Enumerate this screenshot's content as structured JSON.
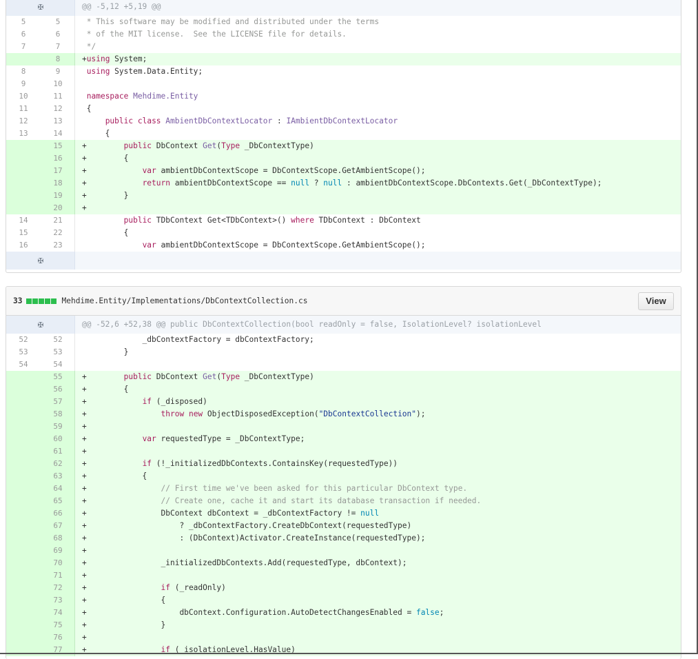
{
  "block1": {
    "hunk_header": "@@ -5,12 +5,19 @@",
    "lines": [
      {
        "type": "ctx",
        "old": "5",
        "new": "5",
        "html": "<span class=\"cm\"> * This software may be modified and distributed under the terms</span>"
      },
      {
        "type": "ctx",
        "old": "6",
        "new": "6",
        "html": "<span class=\"cm\"> * of the MIT license.  See the LICENSE file for details.</span>"
      },
      {
        "type": "ctx",
        "old": "7",
        "new": "7",
        "html": "<span class=\"cm\"> */</span>"
      },
      {
        "type": "add",
        "old": "",
        "new": "8",
        "html": "+<span class=\"kw\">using</span> System;"
      },
      {
        "type": "ctx",
        "old": "8",
        "new": "9",
        "html": " <span class=\"kw\">using</span> System.Data.Entity;"
      },
      {
        "type": "ctx",
        "old": "9",
        "new": "10",
        "html": ""
      },
      {
        "type": "ctx",
        "old": "10",
        "new": "11",
        "html": " <span class=\"kw\">namespace</span> <span class=\"ty\">Mehdime.Entity</span>"
      },
      {
        "type": "ctx",
        "old": "11",
        "new": "12",
        "html": " {"
      },
      {
        "type": "ctx",
        "old": "12",
        "new": "13",
        "html": "     <span class=\"kw\">public</span> <span class=\"kw\">class</span> <span class=\"ty\">AmbientDbContextLocator</span> : <span class=\"ty\">IAmbientDbContextLocator</span>"
      },
      {
        "type": "ctx",
        "old": "13",
        "new": "14",
        "html": "     {"
      },
      {
        "type": "add",
        "old": "",
        "new": "15",
        "html": "+        <span class=\"kw\">public</span> DbContext <span class=\"ty\">Get</span>(<span class=\"kw\">Type</span> _DbContextType)"
      },
      {
        "type": "add",
        "old": "",
        "new": "16",
        "html": "+        {"
      },
      {
        "type": "add",
        "old": "",
        "new": "17",
        "html": "+            <span class=\"kw\">var</span> ambientDbContextScope = DbContextScope.GetAmbientScope();"
      },
      {
        "type": "add",
        "old": "",
        "new": "18",
        "html": "+            <span class=\"kw\">return</span> ambientDbContextScope == <span class=\"nb\">null</span> ? <span class=\"nb\">null</span> : ambientDbContextScope.DbContexts.Get(_DbContextType);"
      },
      {
        "type": "add",
        "old": "",
        "new": "19",
        "html": "+        }"
      },
      {
        "type": "add",
        "old": "",
        "new": "20",
        "html": "+"
      },
      {
        "type": "ctx",
        "old": "14",
        "new": "21",
        "html": "         <span class=\"kw\">public</span> TDbContext Get&lt;TDbContext&gt;() <span class=\"kw\">where</span> TDbContext : DbContext"
      },
      {
        "type": "ctx",
        "old": "15",
        "new": "22",
        "html": "         {"
      },
      {
        "type": "ctx",
        "old": "16",
        "new": "23",
        "html": "             <span class=\"kw\">var</span> ambientDbContextScope = DbContextScope.GetAmbientScope();"
      }
    ]
  },
  "block2": {
    "count": "33",
    "path": "Mehdime.Entity/Implementations/DbContextCollection.cs",
    "view_label": "View",
    "hunk_header": "@@ -52,6 +52,38 @@ public DbContextCollection(bool readOnly = false, IsolationLevel? isolationLevel",
    "lines": [
      {
        "type": "ctx",
        "old": "52",
        "new": "52",
        "html": "             _dbContextFactory = dbContextFactory;"
      },
      {
        "type": "ctx",
        "old": "53",
        "new": "53",
        "html": "         }"
      },
      {
        "type": "ctx",
        "old": "54",
        "new": "54",
        "html": ""
      },
      {
        "type": "add",
        "old": "",
        "new": "55",
        "html": "+        <span class=\"kw\">public</span> DbContext <span class=\"ty\">Get</span>(<span class=\"kw\">Type</span> _DbContextType)"
      },
      {
        "type": "add",
        "old": "",
        "new": "56",
        "html": "+        {"
      },
      {
        "type": "add",
        "old": "",
        "new": "57",
        "html": "+            <span class=\"kw\">if</span> (_disposed)"
      },
      {
        "type": "add",
        "old": "",
        "new": "58",
        "html": "+                <span class=\"kw\">throw</span> <span class=\"kw\">new</span> ObjectDisposedException(<span class=\"st\">\"DbContextCollection\"</span>);"
      },
      {
        "type": "add",
        "old": "",
        "new": "59",
        "html": "+"
      },
      {
        "type": "add",
        "old": "",
        "new": "60",
        "html": "+            <span class=\"kw\">var</span> requestedType = _DbContextType;"
      },
      {
        "type": "add",
        "old": "",
        "new": "61",
        "html": "+"
      },
      {
        "type": "add",
        "old": "",
        "new": "62",
        "html": "+            <span class=\"kw\">if</span> (!_initializedDbContexts.ContainsKey(requestedType))"
      },
      {
        "type": "add",
        "old": "",
        "new": "63",
        "html": "+            {"
      },
      {
        "type": "add",
        "old": "",
        "new": "64",
        "html": "+                <span class=\"cm\">// First time we've been asked for this particular DbContext type.</span>"
      },
      {
        "type": "add",
        "old": "",
        "new": "65",
        "html": "+                <span class=\"cm\">// Create one, cache it and start its database transaction if needed.</span>"
      },
      {
        "type": "add",
        "old": "",
        "new": "66",
        "html": "+                DbContext dbContext = _dbContextFactory != <span class=\"nb\">null</span>"
      },
      {
        "type": "add",
        "old": "",
        "new": "67",
        "html": "+                    ? _dbContextFactory.CreateDbContext(requestedType)"
      },
      {
        "type": "add",
        "old": "",
        "new": "68",
        "html": "+                    : (DbContext)Activator.CreateInstance(requestedType);"
      },
      {
        "type": "add",
        "old": "",
        "new": "69",
        "html": "+"
      },
      {
        "type": "add",
        "old": "",
        "new": "70",
        "html": "+                _initializedDbContexts.Add(requestedType, dbContext);"
      },
      {
        "type": "add",
        "old": "",
        "new": "71",
        "html": "+"
      },
      {
        "type": "add",
        "old": "",
        "new": "72",
        "html": "+                <span class=\"kw\">if</span> (_readOnly)"
      },
      {
        "type": "add",
        "old": "",
        "new": "73",
        "html": "+                {"
      },
      {
        "type": "add",
        "old": "",
        "new": "74",
        "html": "+                    dbContext.Configuration.AutoDetectChangesEnabled = <span class=\"nb\">false</span>;"
      },
      {
        "type": "add",
        "old": "",
        "new": "75",
        "html": "+                }"
      },
      {
        "type": "add",
        "old": "",
        "new": "76",
        "html": "+"
      },
      {
        "type": "add",
        "old": "",
        "new": "77",
        "html": "+                <span class=\"kw\">if</span> (_isolationLevel.HasValue)"
      }
    ]
  }
}
